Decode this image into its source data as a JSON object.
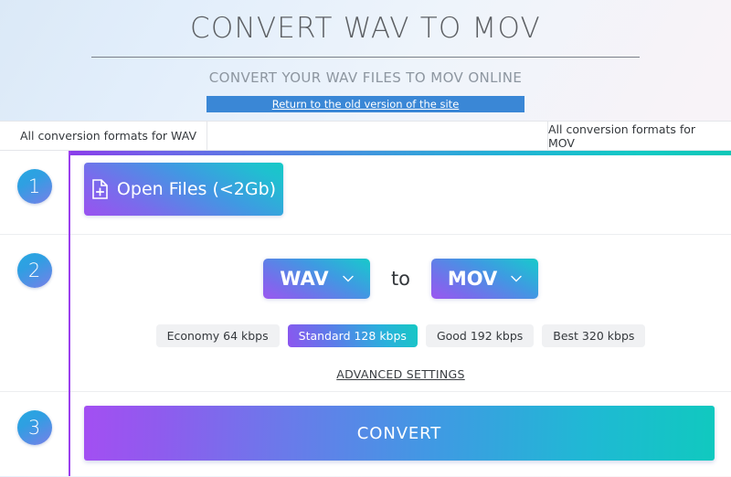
{
  "header": {
    "title": "CONVERT WAV TO MOV",
    "subtitle": "CONVERT YOUR WAV FILES TO MOV ONLINE",
    "old_version_label": "Return to the old version of the site"
  },
  "formats_strip": {
    "left_label": "All conversion formats for WAV",
    "middle_label": "",
    "right_label": "All conversion formats for MOV"
  },
  "steps": {
    "one": {
      "number": "1",
      "open_files_label": "Open Files (<2Gb)",
      "icon": "document-plus-icon"
    },
    "two": {
      "number": "2",
      "source_format": "WAV",
      "target_format": "MOV",
      "to_word": "to",
      "dropdown_icon": "chevron-down-icon",
      "qualities": [
        {
          "label": "Economy 64 kbps",
          "selected": false
        },
        {
          "label": "Standard 128 kbps",
          "selected": true
        },
        {
          "label": "Good 192 kbps",
          "selected": false
        },
        {
          "label": "Best 320 kbps",
          "selected": false
        }
      ],
      "advanced_settings_label": "ADVANCED SETTINGS"
    },
    "three": {
      "number": "3",
      "convert_label": "CONVERT"
    }
  },
  "colors": {
    "accent_purple": "#9b3fee",
    "accent_cyan": "#0ec8b8",
    "old_version_blue": "#3a87d6",
    "title_gray": "#5c5f63",
    "subtitle_gray": "#8d96a0"
  }
}
